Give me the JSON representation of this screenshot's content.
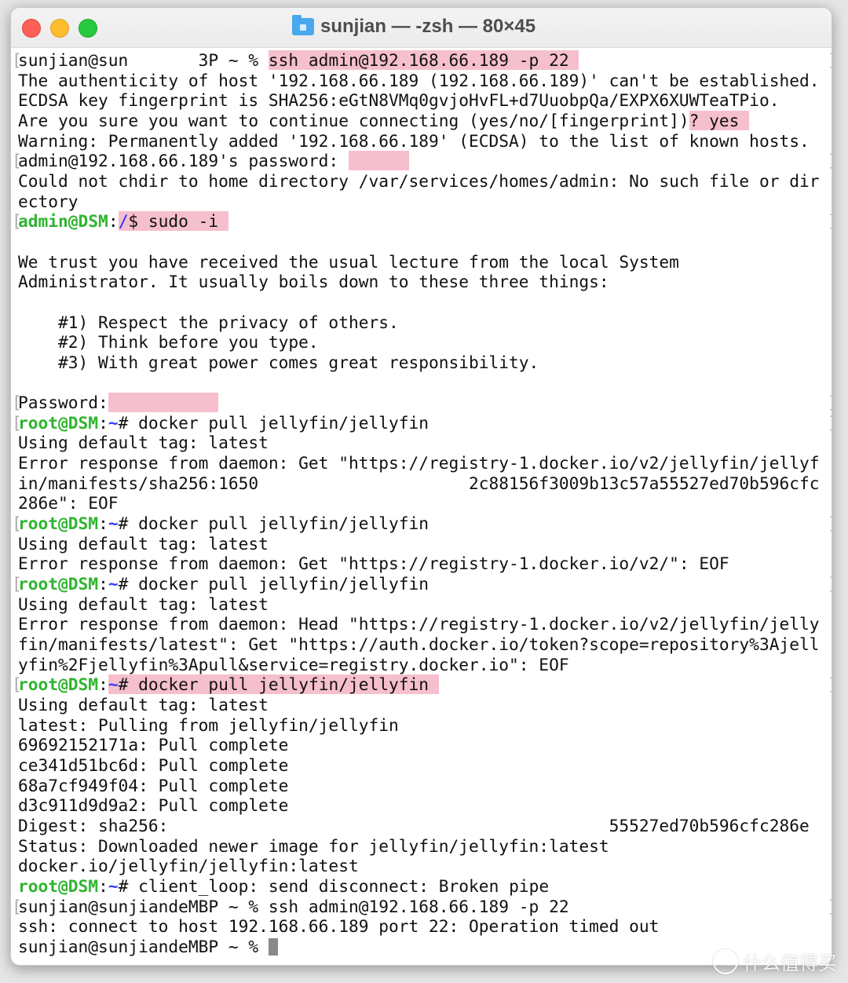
{
  "window": {
    "title": "sunjian — -zsh — 80×45",
    "title_icon": "home-folder-icon"
  },
  "colors": {
    "prompt_green": "#2fb52f",
    "path_blue": "#3a3aff",
    "highlight": "#f6bfcd"
  },
  "terminal": {
    "lines": [
      {
        "mark": true,
        "segs": [
          {
            "t": "sunjian@sun       3P ~ % ",
            "s": "n"
          },
          {
            "t": "ssh admin@192.168.66.189 -p 22 ",
            "s": "hl"
          }
        ]
      },
      {
        "segs": [
          {
            "t": "The authenticity of host '192.168.66.189 (192.168.66.189)' can't be established.",
            "s": "n"
          }
        ]
      },
      {
        "segs": [
          {
            "t": "ECDSA key fingerprint is SHA256:eGtN8VMq0gvjoHvFL+d7UuobpQa/EXPX6XUWTeaTPio.",
            "s": "n"
          }
        ]
      },
      {
        "segs": [
          {
            "t": "Are you sure you want to continue connecting (yes/no/[fingerprint])",
            "s": "n"
          },
          {
            "t": "? yes ",
            "s": "hl"
          }
        ]
      },
      {
        "segs": [
          {
            "t": "Warning: Permanently added '192.168.66.189' (ECDSA) to the list of known hosts.",
            "s": "n"
          }
        ]
      },
      {
        "mark": true,
        "segs": [
          {
            "t": "admin@192.168.66.189's password: ",
            "s": "n"
          },
          {
            "t": "      ",
            "s": "hl"
          }
        ]
      },
      {
        "segs": [
          {
            "t": "Could not chdir to home directory /var/services/homes/admin: No such file or dir",
            "s": "n"
          }
        ]
      },
      {
        "segs": [
          {
            "t": "ectory",
            "s": "n"
          }
        ]
      },
      {
        "mark": true,
        "segs": [
          {
            "t": "admin@DSM",
            "s": "g"
          },
          {
            "t": ":",
            "s": "n"
          },
          {
            "t": "/",
            "s": "hlb"
          },
          {
            "t": "$ sudo -i ",
            "s": "hl"
          }
        ]
      },
      {
        "segs": []
      },
      {
        "segs": [
          {
            "t": "We trust you have received the usual lecture from the local System",
            "s": "n"
          }
        ]
      },
      {
        "segs": [
          {
            "t": "Administrator. It usually boils down to these three things:",
            "s": "n"
          }
        ]
      },
      {
        "segs": []
      },
      {
        "segs": [
          {
            "t": "    #1) Respect the privacy of others.",
            "s": "n"
          }
        ]
      },
      {
        "segs": [
          {
            "t": "    #2) Think before you type.",
            "s": "n"
          }
        ]
      },
      {
        "segs": [
          {
            "t": "    #3) With great power comes great responsibility.",
            "s": "n"
          }
        ]
      },
      {
        "segs": []
      },
      {
        "mark": true,
        "segs": [
          {
            "t": "Password:",
            "s": "n"
          },
          {
            "t": "           ",
            "s": "hl"
          }
        ]
      },
      {
        "mark": true,
        "segs": [
          {
            "t": "root@DSM",
            "s": "g"
          },
          {
            "t": ":",
            "s": "n"
          },
          {
            "t": "~",
            "s": "b"
          },
          {
            "t": "# docker pull jellyfin/jellyfin",
            "s": "n"
          }
        ]
      },
      {
        "segs": [
          {
            "t": "Using default tag: latest",
            "s": "n"
          }
        ]
      },
      {
        "segs": [
          {
            "t": "Error response from daemon: Get \"https://registry-1.docker.io/v2/jellyfin/jellyf",
            "s": "n"
          }
        ]
      },
      {
        "segs": [
          {
            "t": "in/manifests/sha256:1650                     2c88156f3009b13c57a55527ed70b596cfc",
            "s": "n"
          }
        ]
      },
      {
        "segs": [
          {
            "t": "286e\": EOF",
            "s": "n"
          }
        ]
      },
      {
        "mark": true,
        "segs": [
          {
            "t": "root@DSM",
            "s": "g"
          },
          {
            "t": ":",
            "s": "n"
          },
          {
            "t": "~",
            "s": "b"
          },
          {
            "t": "# docker pull jellyfin/jellyfin",
            "s": "n"
          }
        ]
      },
      {
        "segs": [
          {
            "t": "Using default tag: latest",
            "s": "n"
          }
        ]
      },
      {
        "segs": [
          {
            "t": "Error response from daemon: Get \"https://registry-1.docker.io/v2/\": EOF",
            "s": "n"
          }
        ]
      },
      {
        "mark": true,
        "segs": [
          {
            "t": "root@DSM",
            "s": "g"
          },
          {
            "t": ":",
            "s": "n"
          },
          {
            "t": "~",
            "s": "b"
          },
          {
            "t": "# docker pull jellyfin/jellyfin",
            "s": "n"
          }
        ]
      },
      {
        "segs": [
          {
            "t": "Using default tag: latest",
            "s": "n"
          }
        ]
      },
      {
        "segs": [
          {
            "t": "Error response from daemon: Head \"https://registry-1.docker.io/v2/jellyfin/jelly",
            "s": "n"
          }
        ]
      },
      {
        "segs": [
          {
            "t": "fin/manifests/latest\": Get \"https://auth.docker.io/token?scope=repository%3Ajell",
            "s": "n"
          }
        ]
      },
      {
        "segs": [
          {
            "t": "yfin%2Fjellyfin%3Apull&service=registry.docker.io\": EOF",
            "s": "n"
          }
        ]
      },
      {
        "mark": true,
        "segs": [
          {
            "t": "root@DSM",
            "s": "g"
          },
          {
            "t": ":",
            "s": "n"
          },
          {
            "t": "~",
            "s": "hlb"
          },
          {
            "t": "# docker pull jellyfin/jellyfin ",
            "s": "hl"
          }
        ]
      },
      {
        "segs": [
          {
            "t": "Using default tag: latest",
            "s": "n"
          }
        ]
      },
      {
        "segs": [
          {
            "t": "latest: Pulling from jellyfin/jellyfin",
            "s": "n"
          }
        ]
      },
      {
        "segs": [
          {
            "t": "69692152171a: Pull complete",
            "s": "n"
          }
        ]
      },
      {
        "segs": [
          {
            "t": "ce341d51bc6d: Pull complete",
            "s": "n"
          }
        ]
      },
      {
        "segs": [
          {
            "t": "68a7cf949f04: Pull complete",
            "s": "n"
          }
        ]
      },
      {
        "segs": [
          {
            "t": "d3c911d9d9a2: Pull complete",
            "s": "n"
          }
        ]
      },
      {
        "segs": [
          {
            "t": "Digest: sha256:                                            55527ed70b596cfc286e",
            "s": "n"
          }
        ]
      },
      {
        "segs": [
          {
            "t": "Status: Downloaded newer image for jellyfin/jellyfin:latest",
            "s": "n"
          }
        ]
      },
      {
        "segs": [
          {
            "t": "docker.io/jellyfin/jellyfin:latest",
            "s": "n"
          }
        ]
      },
      {
        "segs": [
          {
            "t": "root@DSM",
            "s": "g"
          },
          {
            "t": ":",
            "s": "n"
          },
          {
            "t": "~",
            "s": "b"
          },
          {
            "t": "# client_loop: send disconnect: Broken pipe",
            "s": "n"
          }
        ]
      },
      {
        "mark": true,
        "segs": [
          {
            "t": "sunjian@sunjiandeMBP ~ % ssh admin@192.168.66.189 -p 22",
            "s": "n"
          }
        ]
      },
      {
        "segs": [
          {
            "t": "ssh: connect to host 192.168.66.189 port 22: Operation timed out",
            "s": "n"
          }
        ]
      },
      {
        "cursor": true,
        "segs": [
          {
            "t": "sunjian@sunjiandeMBP ~ % ",
            "s": "n"
          }
        ]
      }
    ]
  },
  "watermark": {
    "text": "什么值得买",
    "icon": "zhi-logo-icon"
  }
}
